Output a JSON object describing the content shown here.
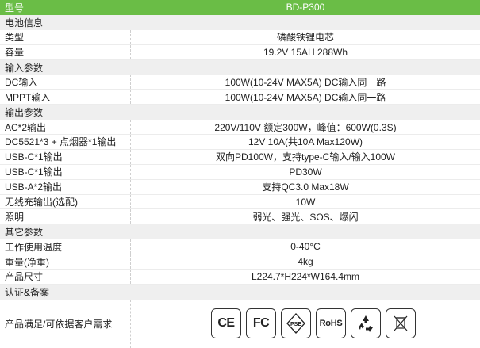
{
  "header": {
    "label": "型号",
    "value": "BD-P300"
  },
  "sections": [
    {
      "title": "电池信息",
      "rows": [
        {
          "label": "类型",
          "value": "磷酸铁锂电芯"
        },
        {
          "label": "容量",
          "value": "19.2V 15AH 288Wh"
        }
      ]
    },
    {
      "title": "输入参数",
      "rows": [
        {
          "label": "DC输入",
          "value": "100W(10-24V MAX5A) DC输入同一路"
        },
        {
          "label": "MPPT输入",
          "value": "100W(10-24V MAX5A) DC输入同一路"
        }
      ]
    },
    {
      "title": "输出参数",
      "rows": [
        {
          "label": "AC*2输出",
          "value": "220V/110V 额定300W，峰值：600W(0.3S)"
        },
        {
          "label": "DC5521*3 + 点烟器*1输出",
          "value": "12V 10A(共10A Max120W)"
        },
        {
          "label": "USB-C*1输出",
          "value": "双向PD100W，支持type-C输入/输入100W"
        },
        {
          "label": "USB-C*1输出",
          "value": "PD30W"
        },
        {
          "label": "USB-A*2输出",
          "value": "支持QC3.0 Max18W"
        },
        {
          "label": "无线充输出(选配)",
          "value": "10W"
        },
        {
          "label": "照明",
          "value": "弱光、强光、SOS、爆闪"
        }
      ]
    },
    {
      "title": "其它参数",
      "rows": [
        {
          "label": "工作使用温度",
          "value": "0-40°C"
        },
        {
          "label": "重量(净重)",
          "value": "4kg"
        },
        {
          "label": "产品尺寸",
          "value": "L224.7*H224*W164.4mm"
        }
      ]
    }
  ],
  "cert": {
    "title": "认证&备案",
    "label": "产品满足/可依据客户需求",
    "icons": [
      {
        "name": "ce-mark-icon",
        "text": "CE"
      },
      {
        "name": "fcc-mark-icon",
        "text": "FC"
      },
      {
        "name": "pse-mark-icon",
        "text": "PSE"
      },
      {
        "name": "rohs-mark-icon",
        "text": "RoHS"
      },
      {
        "name": "recycle-icon",
        "text": ""
      },
      {
        "name": "weee-bin-icon",
        "text": ""
      }
    ]
  },
  "colors": {
    "header": "#6abd46",
    "section": "#efefef"
  }
}
